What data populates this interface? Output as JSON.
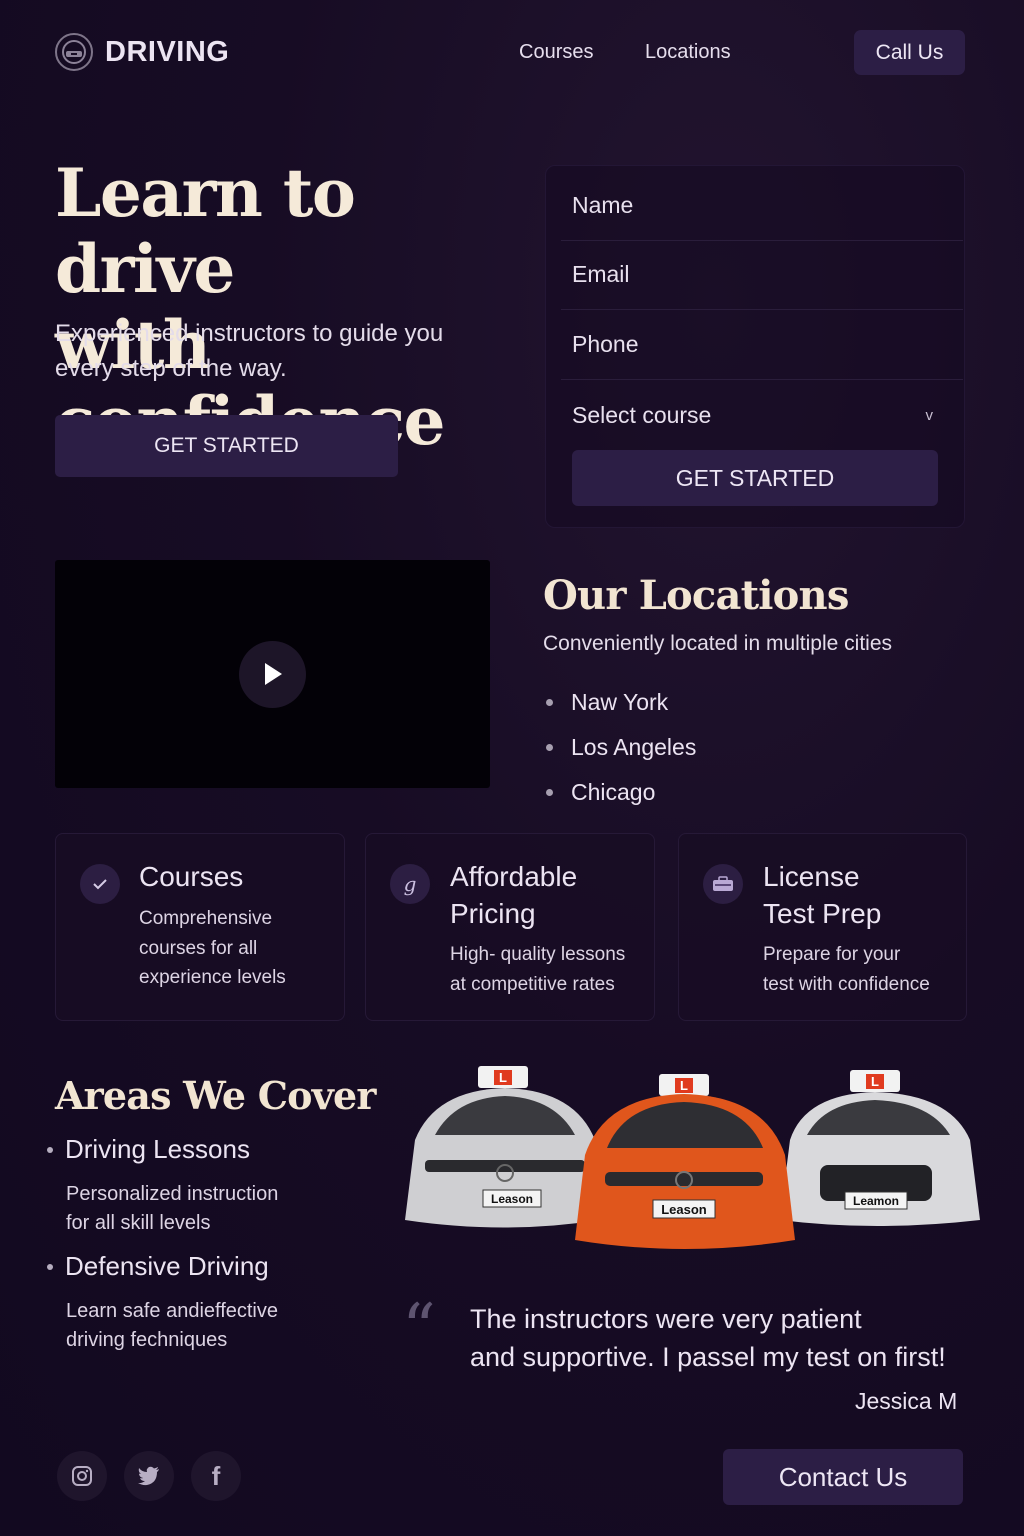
{
  "brand": {
    "name": "DRIVING",
    "icon": "steering-wheel-icon"
  },
  "nav": {
    "courses": "Courses",
    "locations": "Locations",
    "call": "Call Us"
  },
  "hero": {
    "title_line1": "Learn to drive",
    "title_line2": "with confidence",
    "subtitle": "Experienced instructors to guide you every step of the way.",
    "cta": "GET STARTED"
  },
  "form": {
    "name_placeholder": "Name",
    "email_placeholder": "Email",
    "phone_placeholder": "Phone",
    "course_select": "Select course",
    "submit": "GET STARTED"
  },
  "video": {
    "icon": "play-icon"
  },
  "locations": {
    "title": "Our Locations",
    "subtitle": "Conveniently located in multiple cities",
    "cities": [
      "Naw York",
      "Los Angeles",
      "Chicago"
    ]
  },
  "features": [
    {
      "icon": "check-icon",
      "title_line1": "Courses",
      "title_line2": "",
      "text_lines": [
        "Comprehensive",
        "courses for all",
        "experience levels"
      ]
    },
    {
      "icon": "coin-icon",
      "title_line1": "Affordable",
      "title_line2": "Pricing",
      "text_lines": [
        "High- quality lessons",
        "at competitive rates"
      ]
    },
    {
      "icon": "briefcase-icon",
      "title_line1": "License",
      "title_line2": "Test Prep",
      "text_lines": [
        "Prepare for your",
        "test with confidence"
      ]
    }
  ],
  "areas": {
    "title": "Areas We Cover",
    "items": [
      {
        "title": "Driving Lessons",
        "desc_lines": [
          "Personalized instruction",
          "for all skill levels"
        ]
      },
      {
        "title": "Defensive Driving",
        "desc_lines": [
          "Learn safe andieffective",
          "driving fechniques"
        ]
      }
    ]
  },
  "cars": {
    "plates": [
      "Leason",
      "Leason",
      "Leamon"
    ],
    "roof_sign": "L",
    "colors": {
      "left": "#cfcfd2",
      "center": "#e0561c",
      "right": "#d9d9dc"
    }
  },
  "testimonial": {
    "quote_line1": "The instructors were very patient",
    "quote_line2": "and supportive. I passel my test on first!",
    "author": "Jessica M"
  },
  "footer": {
    "social_icons": [
      "instagram-icon",
      "twitter-icon",
      "facebook-icon"
    ],
    "contact": "Contact Us"
  },
  "colors": {
    "background": "#170c24",
    "button": "#2c1e45",
    "heading": "#f5ead9"
  }
}
